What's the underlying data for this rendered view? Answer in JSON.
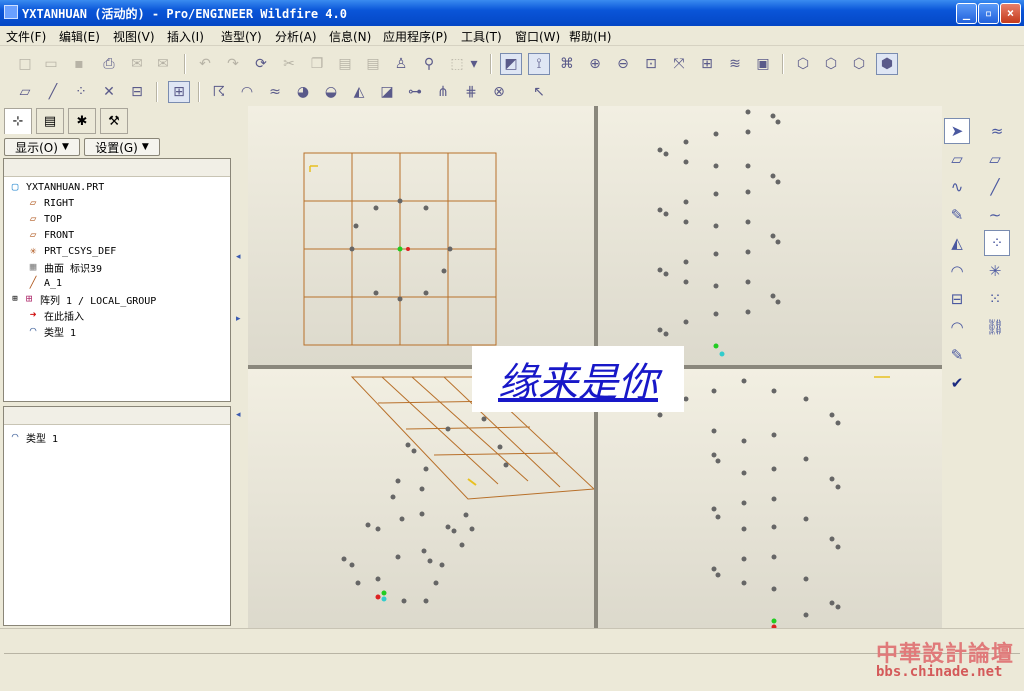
{
  "window": {
    "title": "YXTANHUAN (活动的) - Pro/ENGINEER Wildfire 4.0",
    "minimize_glyph": "_",
    "maximize_glyph": "▫",
    "close_glyph": "×"
  },
  "menu": [
    "文件(F)",
    "编辑(E)",
    "视图(V)",
    "插入(I)",
    "造型(Y)",
    "分析(A)",
    "信息(N)",
    "应用程序(P)",
    "工具(T)",
    "窗口(W)",
    "帮助(H)"
  ],
  "toolbar1": {
    "icons": [
      "new-icon",
      "open-icon",
      "save-icon",
      "print-icon",
      "email-icon",
      "email-link-icon",
      "undo-icon",
      "redo-icon",
      "regenerate-icon",
      "cut-icon",
      "copy-icon",
      "paste-icon",
      "paste-special-icon",
      "model-player-icon",
      "find-icon",
      "select-box-icon",
      "select-dropdown-icon",
      "plane-display-icon",
      "spin-center-icon",
      "named-views-icon",
      "zoom-in-icon",
      "zoom-out-icon",
      "refit-icon",
      "reorient-icon",
      "saved-views-icon",
      "layers-icon",
      "view-manager-icon",
      "wireframe-icon",
      "hidden-line-icon",
      "no-hidden-icon",
      "shading-icon"
    ]
  },
  "toolbar2": {
    "icons": [
      "datum-plane-display-icon",
      "datum-axis-display-icon",
      "point-display-icon",
      "csys-display-icon",
      "annotation-display-icon",
      "spin-center-toggle-icon",
      "curvature-icon",
      "section-analysis-icon",
      "offset-analysis-icon",
      "draft-analysis-icon",
      "dihedral-icon",
      "reflection-icon",
      "shade-curvature-icon",
      "slope-icon",
      "node-icon",
      "deviation-icon",
      "delete-analysis-icon",
      "hide-analysis-icon",
      "whats-this-icon"
    ]
  },
  "left_panel": {
    "tabs": [
      "model-tree-icon",
      "folder-browser-icon",
      "favorites-icon",
      "connections-icon"
    ],
    "show_button": "显示(O)",
    "settings_button": "设置(G)",
    "tree": [
      {
        "label": "YXTANHUAN.PRT",
        "icon": "part-icon",
        "indent": 0
      },
      {
        "label": "RIGHT",
        "icon": "datum-plane-icon",
        "indent": 1
      },
      {
        "label": "TOP",
        "icon": "datum-plane-icon",
        "indent": 1
      },
      {
        "label": "FRONT",
        "icon": "datum-plane-icon",
        "indent": 1
      },
      {
        "label": "PRT_CSYS_DEF",
        "icon": "csys-icon",
        "indent": 1
      },
      {
        "label": "曲面 标识39",
        "icon": "surface-icon",
        "indent": 1
      },
      {
        "label": "A_1",
        "icon": "axis-icon",
        "indent": 1
      },
      {
        "label": "阵列 1 / LOCAL_GROUP",
        "icon": "pattern-icon",
        "indent": 1,
        "expandable": true
      },
      {
        "label": "在此插入",
        "icon": "insert-here-icon",
        "indent": 1
      },
      {
        "label": "类型 1",
        "icon": "style-feature-icon",
        "indent": 1
      }
    ],
    "sub_tree": [
      {
        "label": "类型 1",
        "icon": "style-feature-icon"
      }
    ]
  },
  "overlay_text": "缘来是你",
  "right_toolbar": {
    "icons": [
      "select-icon",
      "style-datum-icon",
      "plane-icon",
      "datum-plane-tool-icon",
      "curve-icon",
      "datum-axis-tool-icon",
      "curve-edit-icon",
      "datum-curve-tool-icon",
      "surface-icon",
      "datum-point-tool-icon",
      "surface-edit-icon",
      "csys-tool-icon",
      "trim-icon",
      "offset-icon",
      "connect-icon",
      "link-icon",
      "accept-icon"
    ]
  },
  "watermark": {
    "line1": "中華設計論壇",
    "line2": "bbs.chinade.net"
  }
}
